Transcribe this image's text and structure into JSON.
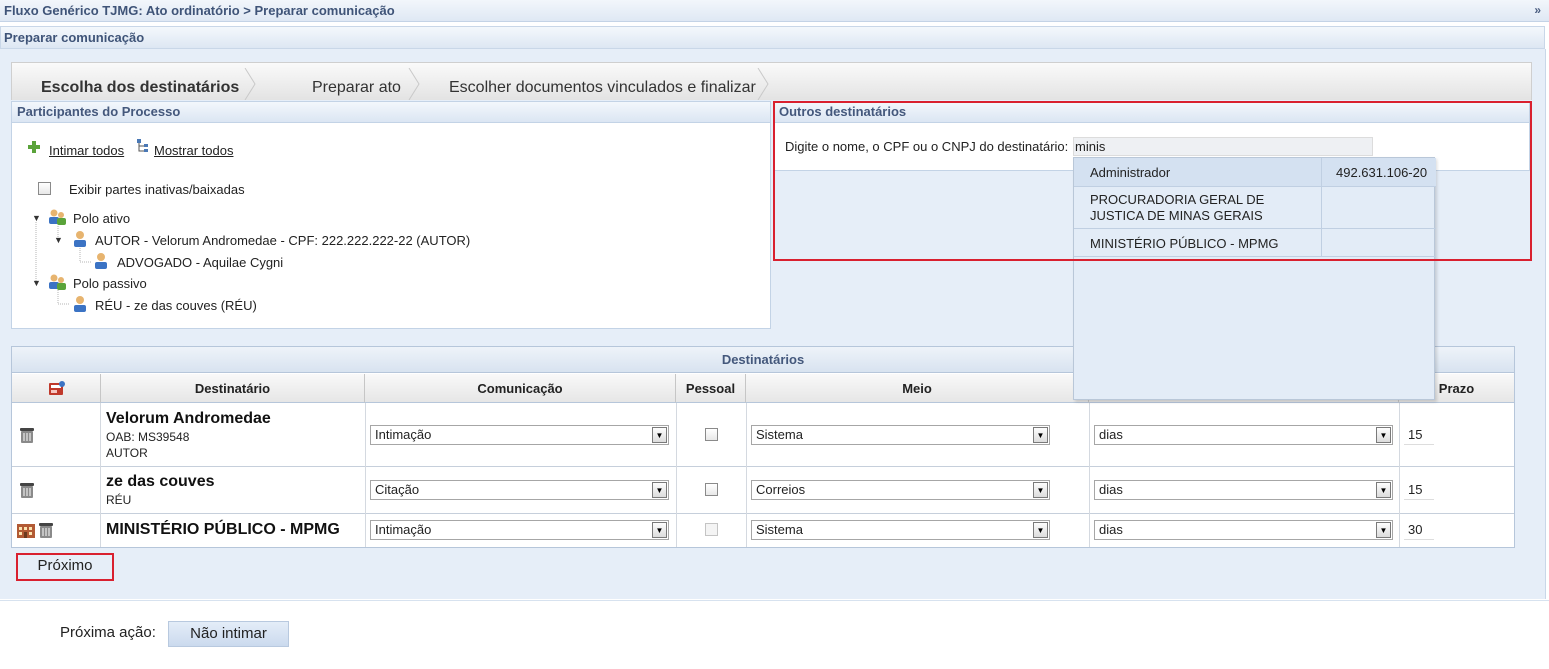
{
  "header": {
    "title": "Fluxo Genérico TJMG: Ato ordinatório > Preparar comunicação",
    "collapse_glyph": "»",
    "subtitle": "Preparar comunicação"
  },
  "tabs": [
    {
      "label": "Escolha dos destinatários",
      "active": true
    },
    {
      "label": "Preparar ato",
      "active": false
    },
    {
      "label": "Escolher documentos vinculados e finalizar",
      "active": false
    }
  ],
  "participantes": {
    "title": "Participantes do Processo",
    "intimar_todos": "Intimar todos",
    "mostrar_todos": "Mostrar todos",
    "exibir_inativas": "Exibir partes inativas/baixadas",
    "tree": {
      "polo_ativo": "Polo ativo",
      "autor": "AUTOR - Velorum Andromedae - CPF: 222.222.222-22 (AUTOR)",
      "advogado": "ADVOGADO - Aquilae Cygni",
      "polo_passivo": "Polo passivo",
      "reu": "RÉU - ze das couves (RÉU)"
    }
  },
  "outros": {
    "title": "Outros destinatários",
    "label": "Digite o nome, o CPF ou o CNPJ do destinatário:",
    "value": "minis",
    "suggestions": [
      {
        "name": "Administrador",
        "doc": "492.631.106-20"
      },
      {
        "name": "PROCURADORIA GERAL DE JUSTICA DE MINAS GERAIS",
        "doc": ""
      },
      {
        "name": "MINISTÉRIO PÚBLICO - MPMG",
        "doc": ""
      }
    ]
  },
  "destinatarios": {
    "title": "Destinatários",
    "columns": [
      "Destinatário",
      "Comunicação",
      "Pessoal",
      "Meio",
      "",
      "Prazo"
    ],
    "rows": [
      {
        "name": "Velorum Andromedae",
        "sub1": "OAB: MS39548",
        "sub2": "AUTOR",
        "comunicacao": "Intimação",
        "meio": "Sistema",
        "unidade": "dias",
        "prazo": "15"
      },
      {
        "name": "ze das couves",
        "sub1": "RÉU",
        "sub2": "",
        "comunicacao": "Citação",
        "meio": "Correios",
        "unidade": "dias",
        "prazo": "15"
      },
      {
        "name": "MINISTÉRIO PÚBLICO - MPMG",
        "sub1": "",
        "sub2": "",
        "comunicacao": "Intimação",
        "meio": "Sistema",
        "unidade": "dias",
        "prazo": "30"
      }
    ]
  },
  "actions": {
    "proximo": "Próximo",
    "proxima_acao_label": "Próxima ação:",
    "nao_intimar": "Não intimar"
  },
  "colors": {
    "highlight": "#d9202f",
    "header_text": "#3f5478",
    "panel_bg": "#e6eef8"
  }
}
